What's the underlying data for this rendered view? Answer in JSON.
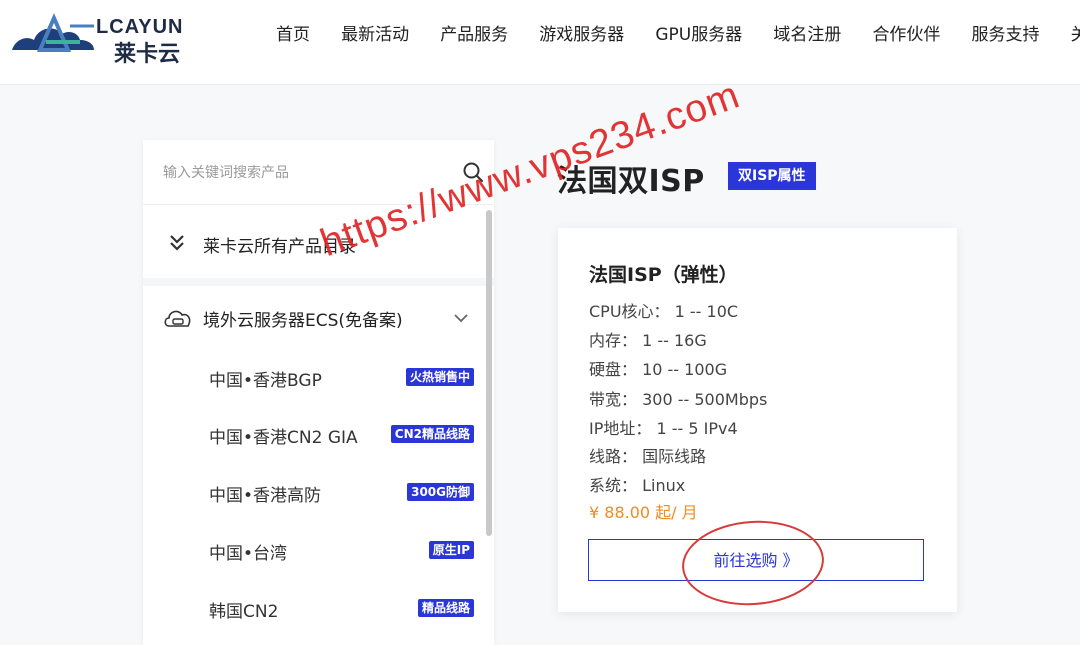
{
  "header": {
    "logo_text": "LCAYUN",
    "logo_cjk": "莱卡云",
    "nav": [
      "首页",
      "最新活动",
      "产品服务",
      "游戏服务器",
      "GPU服务器",
      "域名注册",
      "合作伙伴",
      "服务支持",
      "关"
    ]
  },
  "sidebar": {
    "search_placeholder": "输入关键词搜索产品",
    "catalog_label": "莱卡云所有产品目录",
    "category_label": "境外云服务器ECS(免备案)",
    "items": [
      {
        "label": "中国•香港BGP",
        "badge": "火热销售中"
      },
      {
        "label": "中国•香港CN2 GIA",
        "badge": "CN2精品线路"
      },
      {
        "label": "中国•香港高防",
        "badge": "300G防御"
      },
      {
        "label": "中国•台湾",
        "badge": "原生IP"
      },
      {
        "label": "韩国CN2",
        "badge": "精品线路"
      }
    ]
  },
  "main": {
    "title": "法国双ISP",
    "title_badge": "双ISP属性",
    "card": {
      "title": "法国ISP（弹性）",
      "specs": [
        "CPU核心：  1 -- 10C",
        "内存：  1 -- 16G",
        "硬盘：  10 -- 100G",
        "带宽：  300 -- 500Mbps",
        "IP地址：  1 -- 5 IPv4",
        "线路：  国际线路",
        "系统：  Linux"
      ],
      "price": "¥ 88.00 起/ 月",
      "buy_label": "前往选购 》"
    }
  },
  "watermark": "https://www.vps234.com",
  "colors": {
    "accent": "#2b36d9",
    "price": "#f08c1e",
    "watermark": "#e02424"
  }
}
